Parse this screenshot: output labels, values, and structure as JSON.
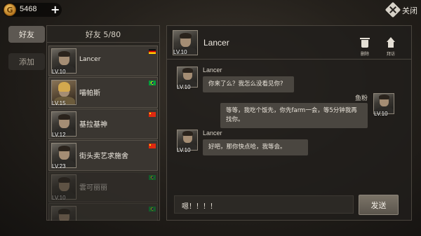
{
  "topbar": {
    "coin_icon": "coin-icon",
    "coin_symbol": "G",
    "coin_amount": "5468",
    "plus_label": "+",
    "close_label": "关闭"
  },
  "side_tabs": [
    {
      "label": "好友",
      "active": true
    },
    {
      "label": "添加",
      "active": false
    }
  ],
  "friend_panel": {
    "header": "好友 5/80",
    "friends": [
      {
        "name": "Lancer",
        "level": "LV.10",
        "flag": "de",
        "online": true
      },
      {
        "name": "喵帕斯",
        "level": "LV.15",
        "flag": "br",
        "online": true
      },
      {
        "name": "基拉基神",
        "level": "LV.12",
        "flag": "cn",
        "online": true
      },
      {
        "name": "街头卖艺求施舍",
        "level": "LV.23",
        "flag": "cn",
        "online": true
      },
      {
        "name": "雲可丽丽",
        "level": "LV.10",
        "flag": "br",
        "online": false
      },
      {
        "name": "",
        "level": "",
        "flag": "br",
        "online": false
      }
    ]
  },
  "chat": {
    "title": "Lancer",
    "level": "LV.10",
    "delete_label": "删除",
    "visit_label": "拜访",
    "messages": [
      {
        "sender": "Lancer",
        "level": "LV.10",
        "side": "left",
        "text": "你来了么？我怎么没看见你?"
      },
      {
        "sender": "鱼粉",
        "level": "LV.10",
        "side": "right",
        "text": "等等，我吃个饭先，你先farm一会，等5分钟我再找你。"
      },
      {
        "sender": "Lancer",
        "level": "LV.10",
        "side": "left",
        "text": "好吧，那你快点哈，我等会。"
      }
    ],
    "input_value": "嗯！！！！",
    "send_label": "发送"
  },
  "colors": {
    "panel_bg": "#2a2622",
    "bubble_bg": "#4a4640",
    "send_button": "#6b645a"
  }
}
